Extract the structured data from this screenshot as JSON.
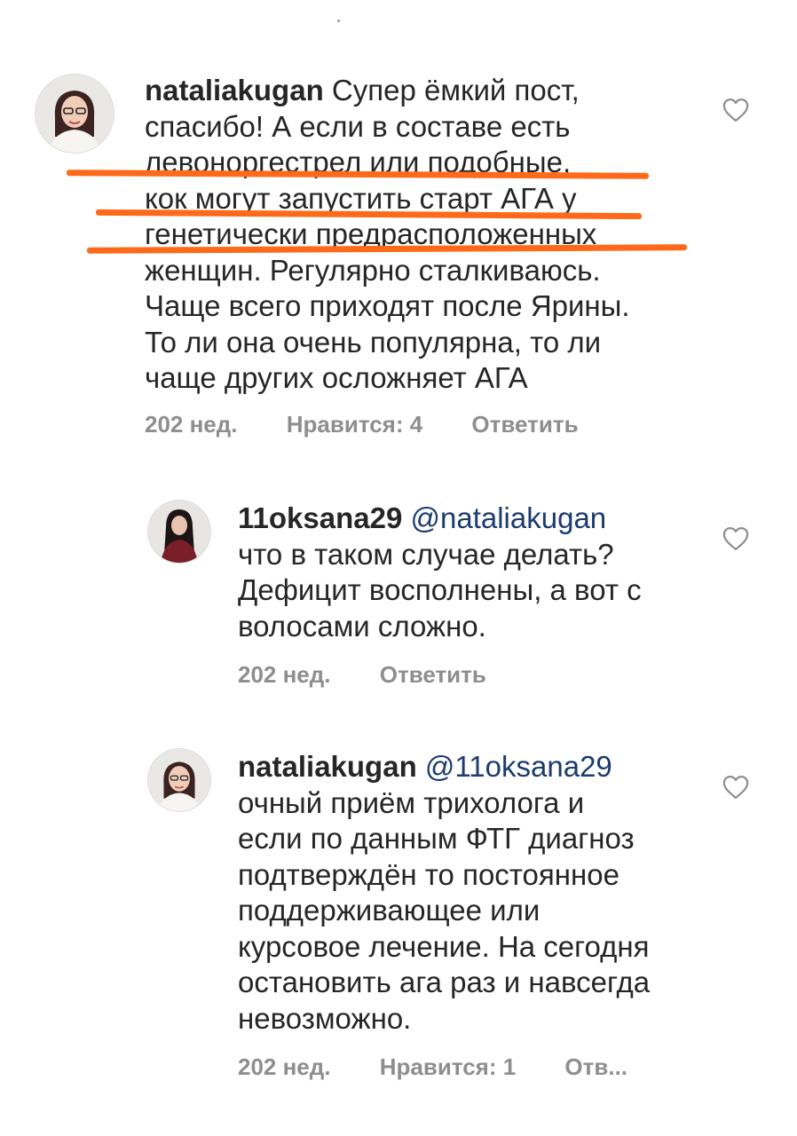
{
  "comments": [
    {
      "username": "nataliakugan",
      "mention": "",
      "lines": [
        "Супер ёмкий пост,",
        "спасибо! А если в составе есть",
        "левоноргестрел или подобные,",
        "кок могут запустить старт АГА у",
        "генетически предрасположенных",
        "женщин. Регулярно сталкиваюсь.",
        "Чаще всего приходят после Ярины.",
        "То ли она очень популярна, то ли",
        "чаще других осложняет АГА"
      ],
      "time": "202 нед.",
      "likes": "Нравится: 4",
      "reply": "Ответить"
    },
    {
      "username": "11oksana29",
      "mention": "@nataliakugan",
      "lines": [
        "что в таком случае делать?",
        "Дефицит восполнены, а вот с",
        "волосами сложно."
      ],
      "time": "202 нед.",
      "likes": "",
      "reply": "Ответить"
    },
    {
      "username": "nataliakugan",
      "mention": "@11oksana29",
      "lines": [
        "очный приём трихолога и",
        "если по данным ФТГ диагноз",
        "подтверждён то постоянное",
        "поддерживающее или",
        "курсовое лечение. На сегодня",
        "остановить ага раз и навсегда",
        "невозможно."
      ],
      "time": "202 нед.",
      "likes": "Нравится: 1",
      "reply": "Отв..."
    }
  ],
  "colors": {
    "text": "#262626",
    "meta": "#8e8e8e",
    "mention": "#1c3b6e",
    "highlight": "#ff6a1a"
  },
  "icons": [
    "heart-icon",
    "avatar"
  ]
}
